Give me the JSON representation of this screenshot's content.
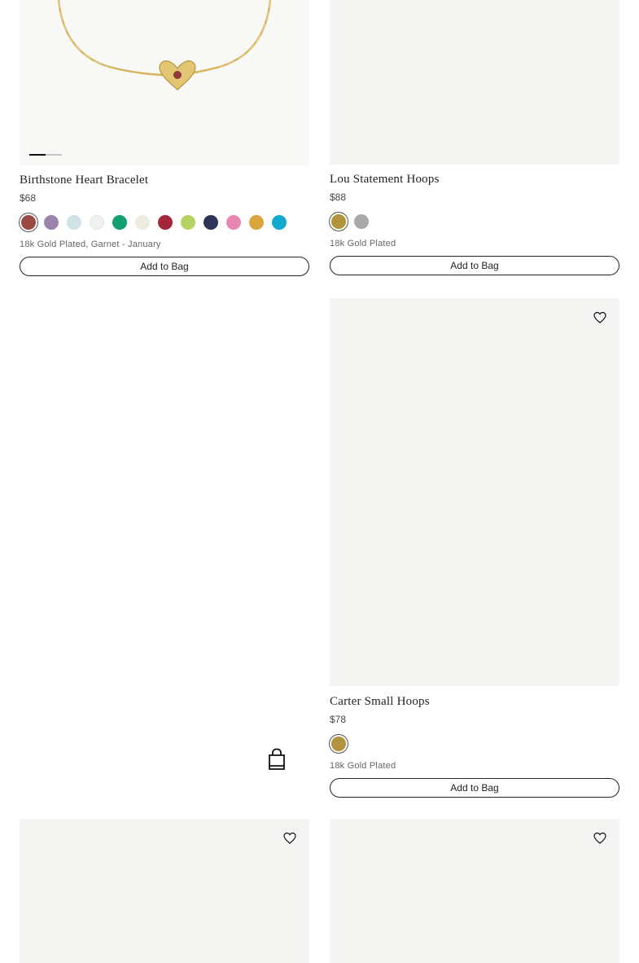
{
  "products": [
    {
      "title": "Birthstone Heart Bracelet",
      "price": "$68",
      "variant": "18k Gold Plated, Garnet - January",
      "add_label": "Add to Bag",
      "swatches": [
        "#9b4a42",
        "#9c85ad",
        "#cfe2e8",
        "#f1f1f1",
        "#11a06e",
        "#eeebdf",
        "#a5253a",
        "#b4d363",
        "#2a3558",
        "#ea86b3",
        "#d9a53c",
        "#13a9cf"
      ],
      "selected_swatch": 0
    },
    {
      "title": "Lou Statement Hoops",
      "price": "$88",
      "variant": "18k Gold Plated",
      "add_label": "Add to Bag",
      "swatches": [
        "#b3943d",
        "#a7a9aa"
      ],
      "selected_swatch": 0
    },
    {
      "title": "Carter Small Hoops",
      "price": "$78",
      "variant": "18k Gold Plated",
      "add_label": "Add to Bag",
      "swatches": [
        "#b3943d"
      ],
      "selected_swatch": 0
    }
  ],
  "icons": {
    "wishlist": "heart-icon",
    "bag": "shopping-bag-icon"
  }
}
